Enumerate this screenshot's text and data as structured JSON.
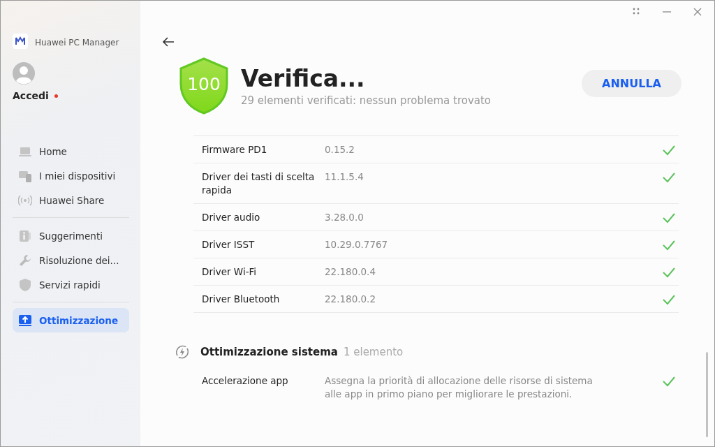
{
  "app": {
    "title": "Huawei PC Manager"
  },
  "account": {
    "label": "Accedi",
    "notification": true
  },
  "sidebar": {
    "groups": [
      [
        {
          "label": "Home",
          "kind": "laptop",
          "selected": false
        },
        {
          "label": "I miei dispositivi",
          "kind": "devices",
          "selected": false
        },
        {
          "label": "Huawei Share",
          "kind": "share",
          "selected": false
        }
      ],
      [
        {
          "label": "Suggerimenti",
          "kind": "tips",
          "selected": false
        },
        {
          "label": "Risoluzione dei...",
          "kind": "wrench",
          "selected": false
        },
        {
          "label": "Servizi rapidi",
          "kind": "shield",
          "selected": false
        }
      ],
      [
        {
          "label": "Ottimizzazione",
          "kind": "optimize",
          "selected": true
        }
      ]
    ]
  },
  "scan": {
    "score": "100",
    "title": "Verifica...",
    "subtitle": "29 elementi verificati: nessun problema trovato",
    "button": "ANNULLA"
  },
  "drivers": [
    {
      "name": "Firmware PD1",
      "value": "0.15.2",
      "checked": true
    },
    {
      "name": "Driver dei tasti di scelta rapida",
      "value": "11.1.5.4",
      "checked": true
    },
    {
      "name": "Driver audio",
      "value": "3.28.0.0",
      "checked": true
    },
    {
      "name": "Driver ISST",
      "value": "10.29.0.7767",
      "checked": true
    },
    {
      "name": "Driver Wi-Fi",
      "value": "22.180.0.4",
      "checked": true
    },
    {
      "name": "Driver Bluetooth",
      "value": "22.180.0.2",
      "checked": true
    }
  ],
  "section": {
    "title": "Ottimizzazione sistema",
    "count": "1 elemento",
    "items": [
      {
        "name": "Accelerazione app",
        "value": "Assegna la priorità di allocazione delle risorse di sistema alle app in primo piano per migliorare le prestazioni.",
        "checked": true
      }
    ]
  }
}
